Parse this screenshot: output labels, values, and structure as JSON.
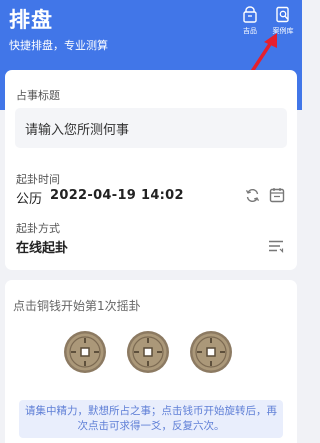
{
  "header": {
    "title": "排盘",
    "subtitle": "快捷排盘，专业测算",
    "actions": [
      {
        "label": "吉品",
        "icon": "gift-bag-icon"
      },
      {
        "label": "案例库",
        "icon": "case-library-search-icon"
      }
    ]
  },
  "form": {
    "question_label": "占事标题",
    "question_placeholder": "请输入您所测何事",
    "time_label": "起卦时间",
    "calendar_type": "公历",
    "datetime": "2022-04-19 14:02",
    "method_label": "起卦方式",
    "method_value": "在线起卦"
  },
  "coins": {
    "hint": "点击铜钱开始第1次摇卦",
    "count": 3,
    "tip": "请集中精力，默想所占之事；点击钱币开始旋转后，再次点击可求得一爻，反复六次。"
  },
  "colors": {
    "primary": "#4176e8",
    "annotation_arrow": "#e5202e",
    "coin_bronze": "#a89373"
  }
}
